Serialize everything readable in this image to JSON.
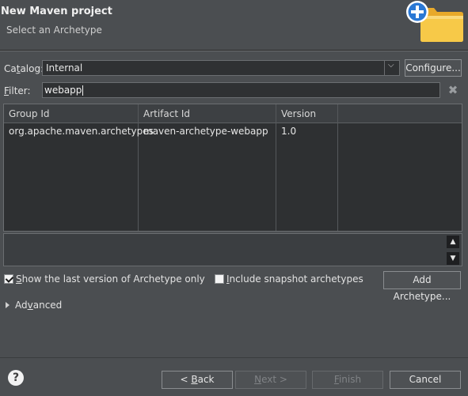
{
  "header": {
    "title": "New Maven project",
    "subtitle": "Select an Archetype",
    "icon": "new-folder-plus-icon"
  },
  "catalog": {
    "label_prefix": "Ca",
    "label_mnemonic": "t",
    "label_suffix": "alog:",
    "value": "Internal",
    "configure_label": "Configure..."
  },
  "filter": {
    "label_mnemonic": "F",
    "label_suffix": "ilter:",
    "value": "webapp"
  },
  "table": {
    "columns": [
      "Group Id",
      "Artifact Id",
      "Version"
    ],
    "rows": [
      [
        "org.apache.maven.archetypes",
        "maven-archetype-webapp",
        "1.0"
      ]
    ]
  },
  "options": {
    "show_last_version": {
      "mnemonic": "S",
      "label": "how the last version of Archetype only",
      "checked": true
    },
    "include_snapshot": {
      "mnemonic": "I",
      "label": "nclude snapshot archetypes",
      "checked": false
    },
    "add_archetype_label": "Add Archetype..."
  },
  "advanced": {
    "prefix": "Ad",
    "mnemonic": "v",
    "suffix": "anced"
  },
  "footer": {
    "back_mnemonic": "B",
    "back_prefix": "< ",
    "back_suffix": "ack",
    "next_mnemonic": "N",
    "next_suffix": "ext >",
    "finish_mnemonic": "F",
    "finish_suffix": "inish",
    "cancel_label": "Cancel"
  },
  "colors": {
    "background": "#4b4e51",
    "field": "#2f3133",
    "folder_yellow": "#f5c542",
    "plus_blue": "#2a78d4"
  }
}
